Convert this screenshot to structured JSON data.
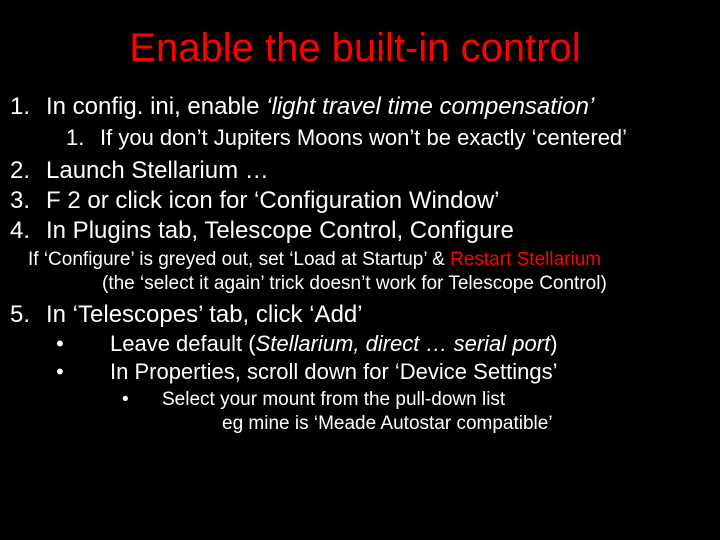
{
  "title": "Enable the built-in control",
  "items": {
    "n1": {
      "num": "1.",
      "a": "In config. ini, enable ",
      "b": "‘light travel time compensation’"
    },
    "n1s1": {
      "num": "1.",
      "text": "If you don’t Jupiters Moons won’t be exactly ‘centered’"
    },
    "n2": {
      "num": "2.",
      "text": "Launch Stellarium …"
    },
    "n3": {
      "num": "3.",
      "text": "F 2 or click icon for ‘Configuration Window’"
    },
    "n4": {
      "num": "4.",
      "text": "In Plugins tab, Telescope Control, Configure"
    },
    "note_a1": "If ‘Configure’ is greyed out, set ‘Load at Startup’ & ",
    "note_a2": "Restart Stellarium",
    "note_b": "(the ‘select it again’ trick doesn’t work for Telescope Control)",
    "n5": {
      "num": "5.",
      "text": "In ‘Telescopes’ tab, click ‘Add’"
    },
    "b1": {
      "bul": "•",
      "a": "Leave default (",
      "b": "Stellarium, direct … serial port",
      "c": ")"
    },
    "b2": {
      "bul": "•",
      "text": "In Properties, scroll down for ‘Device Settings’"
    },
    "sb1": {
      "bul": "•",
      "text": "Select your mount from the pull-down list"
    },
    "sb1b": "eg mine is ‘Meade Autostar compatible’"
  }
}
